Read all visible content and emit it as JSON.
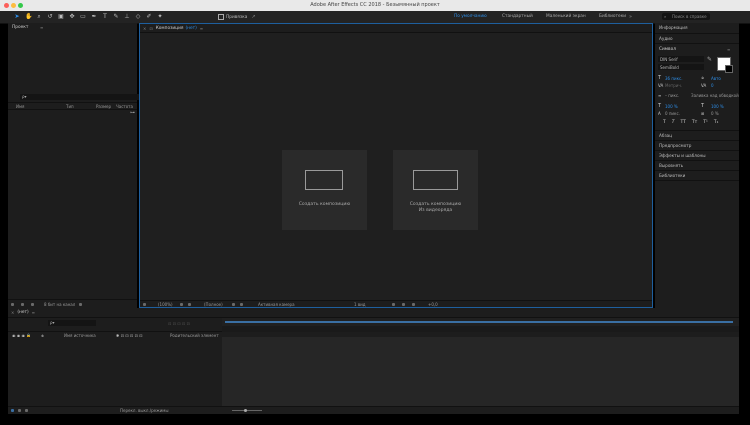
{
  "window": {
    "title": "Adobe After Effects CC 2018 - Безымянный проект"
  },
  "toolbar": {
    "snap_label": "Привязка",
    "workspaces": [
      "По умолчанию",
      "Стандартный",
      "Маленький экран",
      "Библиотеки"
    ],
    "active_workspace": "По умолчанию",
    "search_placeholder": "Поиск в справке"
  },
  "project_panel": {
    "tab": "Проект",
    "search_glyph": "ρ▾",
    "columns": [
      "Имя",
      "Тип",
      "Размер",
      "Частота"
    ],
    "footer_bpc": "8 бит на канал"
  },
  "composition_panel": {
    "tab_prefix": "Композиция",
    "tab_name": "(нет)",
    "create_comp": "Создать композицию",
    "create_from_footage_line1": "Создать композицию",
    "create_from_footage_line2": "Из видеоряда",
    "footer_zoom": "(100%)",
    "footer_res": "(Полное)",
    "footer_camera": "Активная камера",
    "footer_views": "1 вид",
    "footer_exposure": "+0,0"
  },
  "right_panel": {
    "info_tab": "Информация",
    "audio_tab": "Аудио",
    "character_tab": "Символ",
    "font_name": "DIN Serif",
    "font_style": "SemiBold",
    "size_value": "36 пикс.",
    "leading_value": "Авто",
    "kerning_value": "Метрич.",
    "tracking_value": "0",
    "stroke_value": "– пикс.",
    "stroke_mode": "Заливка над обводкой",
    "vscale": "100 %",
    "hscale": "100 %",
    "baseline": "0 пикс.",
    "tsume": "0 %",
    "styles": [
      "T",
      "T",
      "TT",
      "Tт",
      "T¹",
      "T₁"
    ],
    "sections": [
      "Абзац",
      "Предпросмотр",
      "Эффекты и шаблоны",
      "Выровнять",
      "Библиотеки"
    ]
  },
  "timeline_panel": {
    "tab": "(нет)",
    "search_glyph": "ρ▾",
    "col_source_name": "Имя источника",
    "col_parent": "Родительский элемент",
    "footer_label": "Перекл. выкл./режимы"
  },
  "colors": {
    "accent": "#2e8fe9",
    "panel_bg": "#1d1d1d",
    "card_bg": "#2a2a2a",
    "titlebar_bg": "#e9e9e9"
  },
  "icons": [
    "select-tool-icon",
    "hand-tool-icon",
    "zoom-tool-icon",
    "rotate-tool-icon",
    "camera-tool-icon",
    "pan-tool-icon",
    "mask-tool-icon",
    "pen-tool-icon",
    "type-tool-icon",
    "brush-tool-icon",
    "clone-tool-icon",
    "eraser-tool-icon",
    "roto-tool-icon",
    "puppet-tool-icon",
    "search-icon"
  ]
}
